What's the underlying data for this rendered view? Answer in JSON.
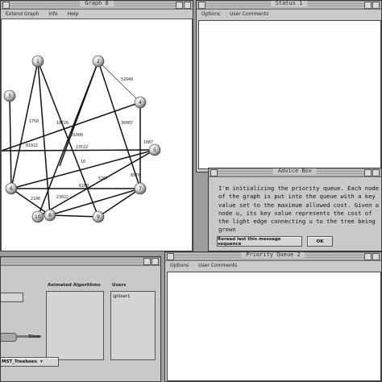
{
  "graph_window": {
    "title": "Graph 8",
    "menu": [
      "Extend Graph",
      "Info",
      "Help"
    ],
    "nodes": [
      {
        "id": "n1",
        "label": "1"
      },
      {
        "id": "n2",
        "label": "2"
      },
      {
        "id": "n3",
        "label": "3"
      },
      {
        "id": "n4",
        "label": "4"
      },
      {
        "id": "n5",
        "label": "5"
      },
      {
        "id": "n6",
        "label": "6"
      },
      {
        "id": "n7",
        "label": "7"
      },
      {
        "id": "n8",
        "label": "8"
      },
      {
        "id": "n9",
        "label": "9"
      },
      {
        "id": "n10",
        "label": "10"
      }
    ],
    "edge_labels": [
      "52040",
      "1750",
      "30007",
      "18726",
      "81000",
      "23522",
      "1087",
      "81022",
      "5267",
      "23022",
      "2106",
      "6160",
      "8578",
      "10"
    ]
  },
  "status_window": {
    "title": "Status 1",
    "menu": [
      "Options",
      "User Comments"
    ]
  },
  "advice_window": {
    "title": "Advice Box",
    "text": "I'm initializing the priority queue. Each node of the graph is put into the queue with a key value set to the maximum allowed cost. Given a node u, its key value represents the cost of the light edge connecting u to the tree being grown",
    "reread_button": "Reread last this message sequence",
    "ok_button": "OK"
  },
  "priority_window": {
    "title": "Priority Queue 2",
    "menu": [
      "Options",
      "User Comments"
    ]
  },
  "control_panel": {
    "animated_header": "Animated Algorithms",
    "users_header": "Users",
    "user_item": "@User1",
    "speed_label": "Slow",
    "algorithm_value": "MST_Treebees"
  }
}
